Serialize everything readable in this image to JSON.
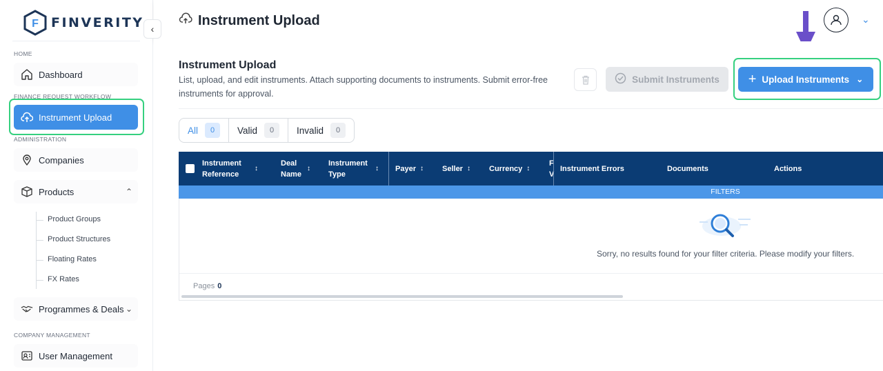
{
  "app": {
    "brand": "FINVERITY",
    "logo_letter": "F"
  },
  "sidebar": {
    "sections": {
      "home": "HOME",
      "finance": "FINANCE REQUEST WORKFLOW",
      "administration": "ADMINISTRATION",
      "company": "COMPANY MANAGEMENT"
    },
    "items": {
      "dashboard": "Dashboard",
      "instrument_upload": "Instrument Upload",
      "companies": "Companies",
      "products": "Products",
      "programmes": "Programmes & Deals",
      "user_management": "User Management"
    },
    "product_subitems": [
      "Product Groups",
      "Product Structures",
      "Floating Rates",
      "FX Rates"
    ]
  },
  "header": {
    "title": "Instrument Upload"
  },
  "main": {
    "title": "Instrument Upload",
    "description": "List, upload, and edit instruments. Attach supporting documents to instruments. Submit error-free instruments for approval.",
    "submit_label": "Submit Instruments",
    "upload_label": "Upload Instruments",
    "tabs": [
      {
        "label": "All",
        "count": "0"
      },
      {
        "label": "Valid",
        "count": "0"
      },
      {
        "label": "Invalid",
        "count": "0"
      }
    ],
    "table": {
      "columns": [
        "Instrument Reference",
        "Deal Name",
        "Instrument Type",
        "Payer",
        "Seller",
        "Currency",
        "F V",
        "Instrument Errors",
        "Documents",
        "Actions"
      ],
      "filters_label": "FILTERS",
      "empty_message": "Sorry, no results found for your filter criteria. Please modify your filters.",
      "pages_label": "Pages",
      "pages_value": "0"
    }
  },
  "colors": {
    "accent": "#3f8fe6",
    "header_bg": "#0b3c74",
    "highlight": "#35d07f",
    "annotation_arrow": "#6a4fc9"
  }
}
